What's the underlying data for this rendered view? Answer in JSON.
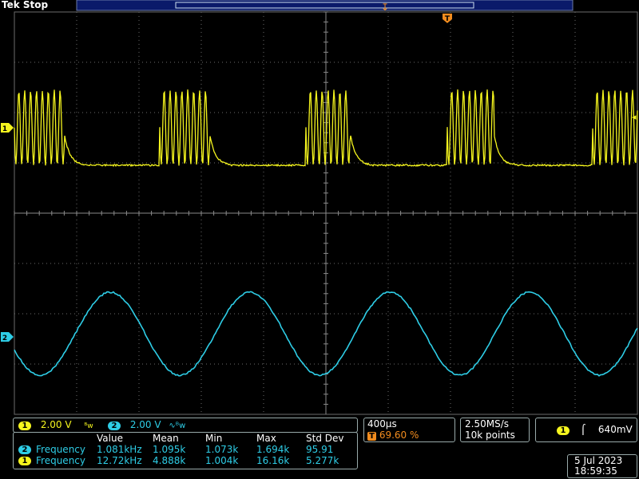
{
  "app": {
    "brand": "Tek",
    "state": "Stop"
  },
  "channels": {
    "ch1": {
      "id": "1",
      "scale": "2.00 V",
      "bw_marker": "ᴮw",
      "color": "#f5f51e"
    },
    "ch2": {
      "id": "2",
      "scale": "2.00 V",
      "coupling_symbol": "∿ᴮw",
      "color": "#2ecde6"
    }
  },
  "timebase": {
    "scale": "400µs",
    "trigger_position": "69.60 %"
  },
  "acquisition": {
    "sample_rate": "2.50MS/s",
    "record_length": "10k points"
  },
  "trigger": {
    "source": "1",
    "slope_symbol": "⌠",
    "level": "640mV"
  },
  "measurements": {
    "headers": [
      "Value",
      "Mean",
      "Min",
      "Max",
      "Std Dev"
    ],
    "rows": [
      {
        "channel": "2",
        "name": "Frequency",
        "value": "1.081kHz",
        "mean": "1.095k",
        "min": "1.073k",
        "max": "1.694k",
        "std": "95.91"
      },
      {
        "channel": "1",
        "name": "Frequency",
        "value": "12.72kHz",
        "mean": "4.888k",
        "min": "1.004k",
        "max": "16.16k",
        "std": "5.277k"
      }
    ]
  },
  "datetime": {
    "date": "5 Jul  2023",
    "time": "18:59:35"
  },
  "markers": {
    "ch1": "1",
    "ch2": "2",
    "trigger_t": "T"
  }
}
